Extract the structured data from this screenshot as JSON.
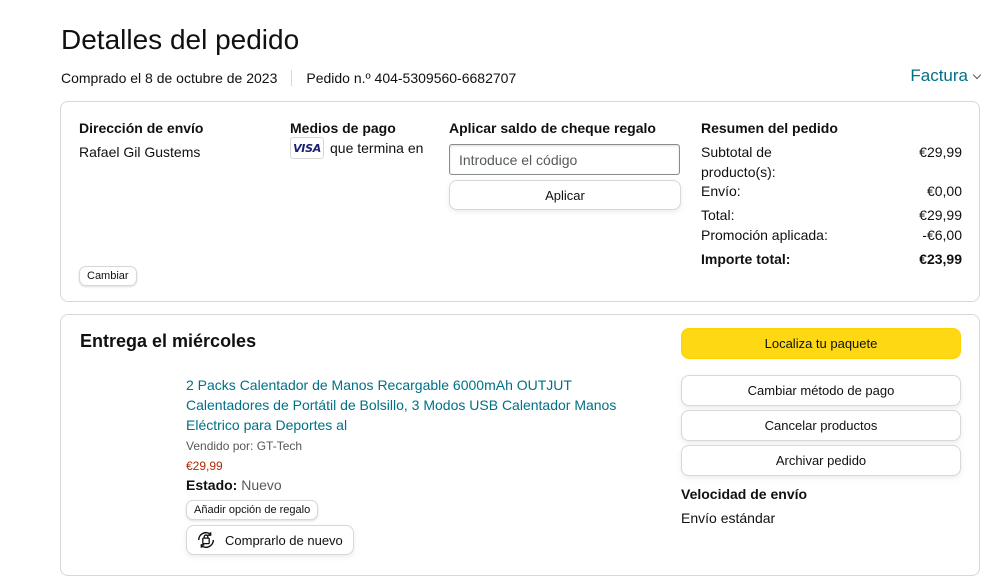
{
  "header": {
    "title": "Detalles del pedido",
    "ordered_date": "Comprado el 8 de octubre de 2023",
    "order_number": "Pedido n.º 404-5309560-6682707",
    "invoice_label": "Factura"
  },
  "summary_card": {
    "shipping": {
      "title": "Dirección de envío",
      "name": "Rafael Gil Gustems",
      "change_label": "Cambiar"
    },
    "payment": {
      "title": "Medios de pago",
      "card_brand": "VISA",
      "card_text": "que termina en"
    },
    "gift": {
      "title": "Aplicar saldo de cheque regalo",
      "placeholder": "Introduce el código",
      "apply_label": "Aplicar"
    },
    "order_summary": {
      "title": "Resumen del pedido",
      "rows": [
        {
          "label": "Subtotal de producto(s):",
          "value": "€29,99"
        },
        {
          "label": "Envío:",
          "value": "€0,00"
        },
        {
          "label": "Total:",
          "value": "€29,99"
        },
        {
          "label": "Promoción aplicada:",
          "value": "-€6,00"
        }
      ],
      "grand_total": {
        "label": "Importe total:",
        "value": "€23,99"
      }
    }
  },
  "shipment": {
    "title": "Entrega el miércoles",
    "product": {
      "name": "2 Packs Calentador de Manos Recargable 6000mAh OUTJUT Calentadores de Portátil de Bolsillo, 3 Modos USB Calentador Manos Eléctrico para Deportes al",
      "sold_by": "Vendido por: GT-Tech",
      "price": "€29,99",
      "status_label": "Estado:",
      "status_value": "Nuevo",
      "gift_option_label": "Añadir opción de regalo",
      "buy_again_label": "Comprarlo de nuevo"
    },
    "actions": {
      "track": "Localiza tu paquete",
      "change_payment": "Cambiar método de pago",
      "cancel": "Cancelar productos",
      "archive": "Archivar pedido"
    },
    "shipping_speed": {
      "title": "Velocidad de envío",
      "value": "Envío estándar"
    }
  },
  "colors": {
    "link": "#007185",
    "price": "#b12704",
    "primary_button": "#ffd814",
    "border": "#d5d9d9"
  }
}
